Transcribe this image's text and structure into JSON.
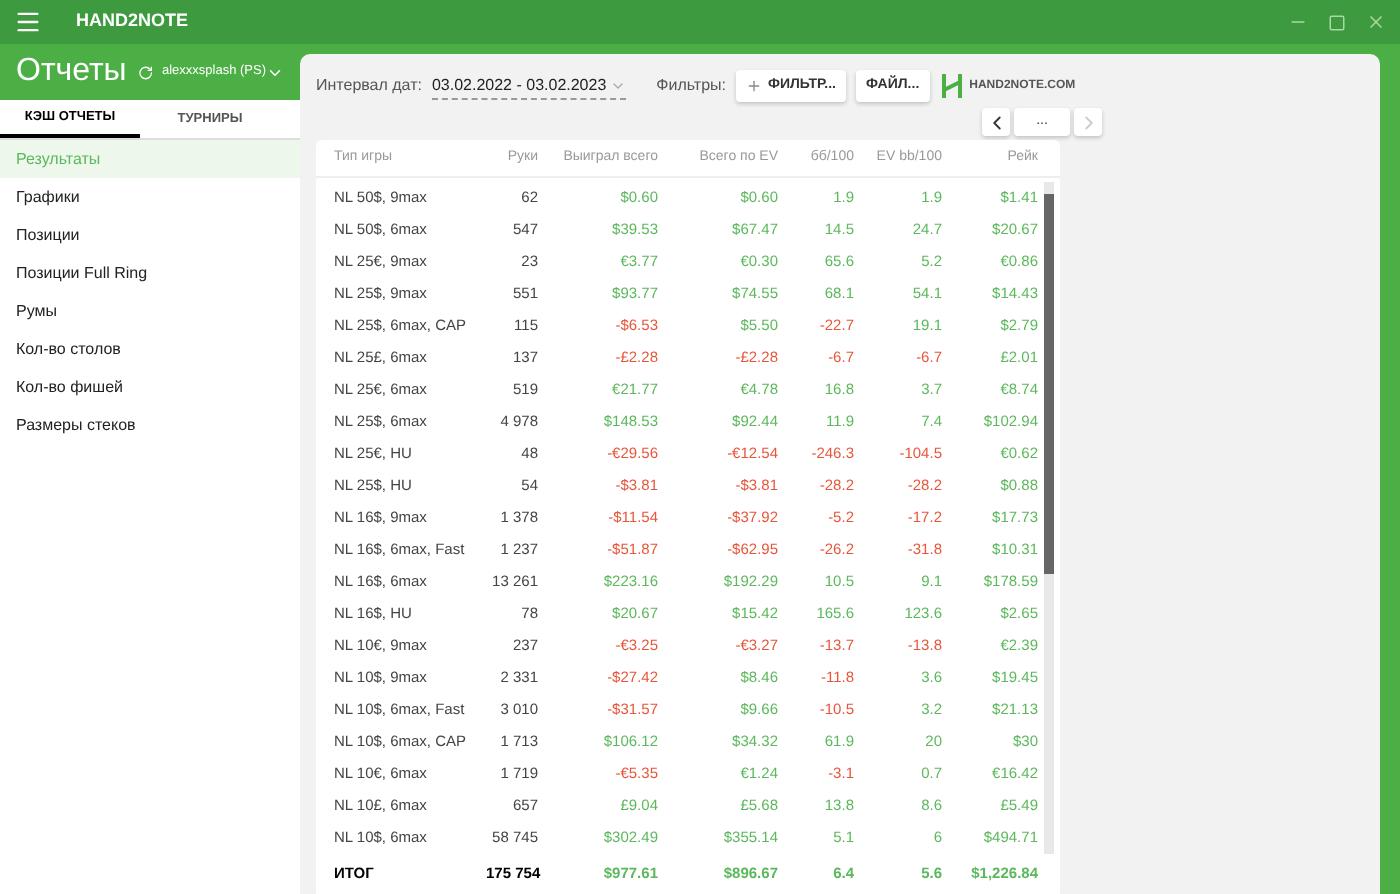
{
  "app_bar": {
    "title": "HAND2NOTE"
  },
  "header": {
    "title": "Отчеты",
    "account": "alexxxsplash (PS)"
  },
  "tabs": [
    {
      "label": "КЭШ ОТЧЕТЫ",
      "selected": true
    },
    {
      "label": "ТУРНИРЫ",
      "selected": false
    }
  ],
  "sidebar": {
    "items": [
      {
        "label": "Результаты",
        "selected": true
      },
      {
        "label": "Графики",
        "selected": false
      },
      {
        "label": "Позиции",
        "selected": false
      },
      {
        "label": "Позиции Full Ring",
        "selected": false
      },
      {
        "label": "Румы",
        "selected": false
      },
      {
        "label": "Кол-во столов",
        "selected": false
      },
      {
        "label": "Кол-во фишей",
        "selected": false
      },
      {
        "label": "Размеры стеков",
        "selected": false
      }
    ]
  },
  "toolbar": {
    "date_label": "Интервал дат:",
    "date_range": "03.02.2022 - 03.02.2023",
    "filters_label": "Фильтры:",
    "filter_button": "ФИЛЬТР...",
    "file_button": "ФАЙЛ...",
    "logo_text": "HAND2NOTE.COM",
    "nav": [
      {
        "kind": "prev",
        "disabled": false
      },
      {
        "kind": "more",
        "label": "...",
        "disabled": false
      },
      {
        "kind": "next",
        "disabled": true
      }
    ]
  },
  "table": {
    "columns": [
      "Тип игры",
      "Руки",
      "Выиграл всего",
      "Всего по EV",
      "бб/100",
      "EV bb/100",
      "Рейк"
    ],
    "rows": [
      {
        "cells": [
          {
            "text": "NL 50$, 9max",
            "negative": false
          },
          {
            "text": "62",
            "negative": false
          },
          {
            "text": "$0.60",
            "negative": false
          },
          {
            "text": "$0.60",
            "negative": false
          },
          {
            "text": "1.9",
            "negative": false
          },
          {
            "text": "1.9",
            "negative": false
          },
          {
            "text": "$1.41",
            "negative": false
          }
        ]
      },
      {
        "cells": [
          {
            "text": "NL 50$, 6max",
            "negative": false
          },
          {
            "text": "547",
            "negative": false
          },
          {
            "text": "$39.53",
            "negative": false
          },
          {
            "text": "$67.47",
            "negative": false
          },
          {
            "text": "14.5",
            "negative": false
          },
          {
            "text": "24.7",
            "negative": false
          },
          {
            "text": "$20.67",
            "negative": false
          }
        ]
      },
      {
        "cells": [
          {
            "text": "NL 25€, 9max",
            "negative": false
          },
          {
            "text": "23",
            "negative": false
          },
          {
            "text": "€3.77",
            "negative": false
          },
          {
            "text": "€0.30",
            "negative": false
          },
          {
            "text": "65.6",
            "negative": false
          },
          {
            "text": "5.2",
            "negative": false
          },
          {
            "text": "€0.86",
            "negative": false
          }
        ]
      },
      {
        "cells": [
          {
            "text": "NL 25$, 9max",
            "negative": false
          },
          {
            "text": "551",
            "negative": false
          },
          {
            "text": "$93.77",
            "negative": false
          },
          {
            "text": "$74.55",
            "negative": false
          },
          {
            "text": "68.1",
            "negative": false
          },
          {
            "text": "54.1",
            "negative": false
          },
          {
            "text": "$14.43",
            "negative": false
          }
        ]
      },
      {
        "cells": [
          {
            "text": "NL 25$, 6max, CAP",
            "negative": false
          },
          {
            "text": "115",
            "negative": false
          },
          {
            "text": "-$6.53",
            "negative": true
          },
          {
            "text": "$5.50",
            "negative": false
          },
          {
            "text": "-22.7",
            "negative": true
          },
          {
            "text": "19.1",
            "negative": false
          },
          {
            "text": "$2.79",
            "negative": false
          }
        ]
      },
      {
        "cells": [
          {
            "text": "NL 25£, 6max",
            "negative": false
          },
          {
            "text": "137",
            "negative": false
          },
          {
            "text": "-£2.28",
            "negative": true
          },
          {
            "text": "-£2.28",
            "negative": true
          },
          {
            "text": "-6.7",
            "negative": true
          },
          {
            "text": "-6.7",
            "negative": true
          },
          {
            "text": "£2.01",
            "negative": false
          }
        ]
      },
      {
        "cells": [
          {
            "text": "NL 25€, 6max",
            "negative": false
          },
          {
            "text": "519",
            "negative": false
          },
          {
            "text": "€21.77",
            "negative": false
          },
          {
            "text": "€4.78",
            "negative": false
          },
          {
            "text": "16.8",
            "negative": false
          },
          {
            "text": "3.7",
            "negative": false
          },
          {
            "text": "€8.74",
            "negative": false
          }
        ]
      },
      {
        "cells": [
          {
            "text": "NL 25$, 6max",
            "negative": false
          },
          {
            "text": "4 978",
            "negative": false
          },
          {
            "text": "$148.53",
            "negative": false
          },
          {
            "text": "$92.44",
            "negative": false
          },
          {
            "text": "11.9",
            "negative": false
          },
          {
            "text": "7.4",
            "negative": false
          },
          {
            "text": "$102.94",
            "negative": false
          }
        ]
      },
      {
        "cells": [
          {
            "text": "NL 25€, HU",
            "negative": false
          },
          {
            "text": "48",
            "negative": false
          },
          {
            "text": "-€29.56",
            "negative": true
          },
          {
            "text": "-€12.54",
            "negative": true
          },
          {
            "text": "-246.3",
            "negative": true
          },
          {
            "text": "-104.5",
            "negative": true
          },
          {
            "text": "€0.62",
            "negative": false
          }
        ]
      },
      {
        "cells": [
          {
            "text": "NL 25$, HU",
            "negative": false
          },
          {
            "text": "54",
            "negative": false
          },
          {
            "text": "-$3.81",
            "negative": true
          },
          {
            "text": "-$3.81",
            "negative": true
          },
          {
            "text": "-28.2",
            "negative": true
          },
          {
            "text": "-28.2",
            "negative": true
          },
          {
            "text": "$0.88",
            "negative": false
          }
        ]
      },
      {
        "cells": [
          {
            "text": "NL 16$, 9max",
            "negative": false
          },
          {
            "text": "1 378",
            "negative": false
          },
          {
            "text": "-$11.54",
            "negative": true
          },
          {
            "text": "-$37.92",
            "negative": true
          },
          {
            "text": "-5.2",
            "negative": true
          },
          {
            "text": "-17.2",
            "negative": true
          },
          {
            "text": "$17.73",
            "negative": false
          }
        ]
      },
      {
        "cells": [
          {
            "text": "NL 16$, 6max, Fast",
            "negative": false
          },
          {
            "text": "1 237",
            "negative": false
          },
          {
            "text": "-$51.87",
            "negative": true
          },
          {
            "text": "-$62.95",
            "negative": true
          },
          {
            "text": "-26.2",
            "negative": true
          },
          {
            "text": "-31.8",
            "negative": true
          },
          {
            "text": "$10.31",
            "negative": false
          }
        ]
      },
      {
        "cells": [
          {
            "text": "NL 16$, 6max",
            "negative": false
          },
          {
            "text": "13 261",
            "negative": false
          },
          {
            "text": "$223.16",
            "negative": false
          },
          {
            "text": "$192.29",
            "negative": false
          },
          {
            "text": "10.5",
            "negative": false
          },
          {
            "text": "9.1",
            "negative": false
          },
          {
            "text": "$178.59",
            "negative": false
          }
        ]
      },
      {
        "cells": [
          {
            "text": "NL 16$, HU",
            "negative": false
          },
          {
            "text": "78",
            "negative": false
          },
          {
            "text": "$20.67",
            "negative": false
          },
          {
            "text": "$15.42",
            "negative": false
          },
          {
            "text": "165.6",
            "negative": false
          },
          {
            "text": "123.6",
            "negative": false
          },
          {
            "text": "$2.65",
            "negative": false
          }
        ]
      },
      {
        "cells": [
          {
            "text": "NL 10€, 9max",
            "negative": false
          },
          {
            "text": "237",
            "negative": false
          },
          {
            "text": "-€3.25",
            "negative": true
          },
          {
            "text": "-€3.27",
            "negative": true
          },
          {
            "text": "-13.7",
            "negative": true
          },
          {
            "text": "-13.8",
            "negative": true
          },
          {
            "text": "€2.39",
            "negative": false
          }
        ]
      },
      {
        "cells": [
          {
            "text": "NL 10$, 9max",
            "negative": false
          },
          {
            "text": "2 331",
            "negative": false
          },
          {
            "text": "-$27.42",
            "negative": true
          },
          {
            "text": "$8.46",
            "negative": false
          },
          {
            "text": "-11.8",
            "negative": true
          },
          {
            "text": "3.6",
            "negative": false
          },
          {
            "text": "$19.45",
            "negative": false
          }
        ]
      },
      {
        "cells": [
          {
            "text": "NL 10$, 6max, Fast",
            "negative": false
          },
          {
            "text": "3 010",
            "negative": false
          },
          {
            "text": "-$31.57",
            "negative": true
          },
          {
            "text": "$9.66",
            "negative": false
          },
          {
            "text": "-10.5",
            "negative": true
          },
          {
            "text": "3.2",
            "negative": false
          },
          {
            "text": "$21.13",
            "negative": false
          }
        ]
      },
      {
        "cells": [
          {
            "text": "NL 10$, 6max, CAP",
            "negative": false
          },
          {
            "text": "1 713",
            "negative": false
          },
          {
            "text": "$106.12",
            "negative": false
          },
          {
            "text": "$34.32",
            "negative": false
          },
          {
            "text": "61.9",
            "negative": false
          },
          {
            "text": "20",
            "negative": false
          },
          {
            "text": "$30",
            "negative": false
          }
        ]
      },
      {
        "cells": [
          {
            "text": "NL 10€, 6max",
            "negative": false
          },
          {
            "text": "1 719",
            "negative": false
          },
          {
            "text": "-€5.35",
            "negative": true
          },
          {
            "text": "€1.24",
            "negative": false
          },
          {
            "text": "-3.1",
            "negative": true
          },
          {
            "text": "0.7",
            "negative": false
          },
          {
            "text": "€16.42",
            "negative": false
          }
        ]
      },
      {
        "cells": [
          {
            "text": "NL 10£, 6max",
            "negative": false
          },
          {
            "text": "657",
            "negative": false
          },
          {
            "text": "£9.04",
            "negative": false
          },
          {
            "text": "£5.68",
            "negative": false
          },
          {
            "text": "13.8",
            "negative": false
          },
          {
            "text": "8.6",
            "negative": false
          },
          {
            "text": "£5.49",
            "negative": false
          }
        ]
      },
      {
        "cells": [
          {
            "text": "NL 10$, 6max",
            "negative": false
          },
          {
            "text": "58 745",
            "negative": false
          },
          {
            "text": "$302.49",
            "negative": false
          },
          {
            "text": "$355.14",
            "negative": false
          },
          {
            "text": "5.1",
            "negative": false
          },
          {
            "text": "6",
            "negative": false
          },
          {
            "text": "$494.71",
            "negative": false
          }
        ]
      }
    ],
    "total": {
      "cells": [
        {
          "text": "ИТОГ",
          "negative": false
        },
        {
          "text": "175 754",
          "negative": false
        },
        {
          "text": "$977.61",
          "negative": false
        },
        {
          "text": "$896.67",
          "negative": false
        },
        {
          "text": "6.4",
          "negative": false
        },
        {
          "text": "5.6",
          "negative": false
        },
        {
          "text": "$1,226.84",
          "negative": false
        }
      ]
    }
  }
}
